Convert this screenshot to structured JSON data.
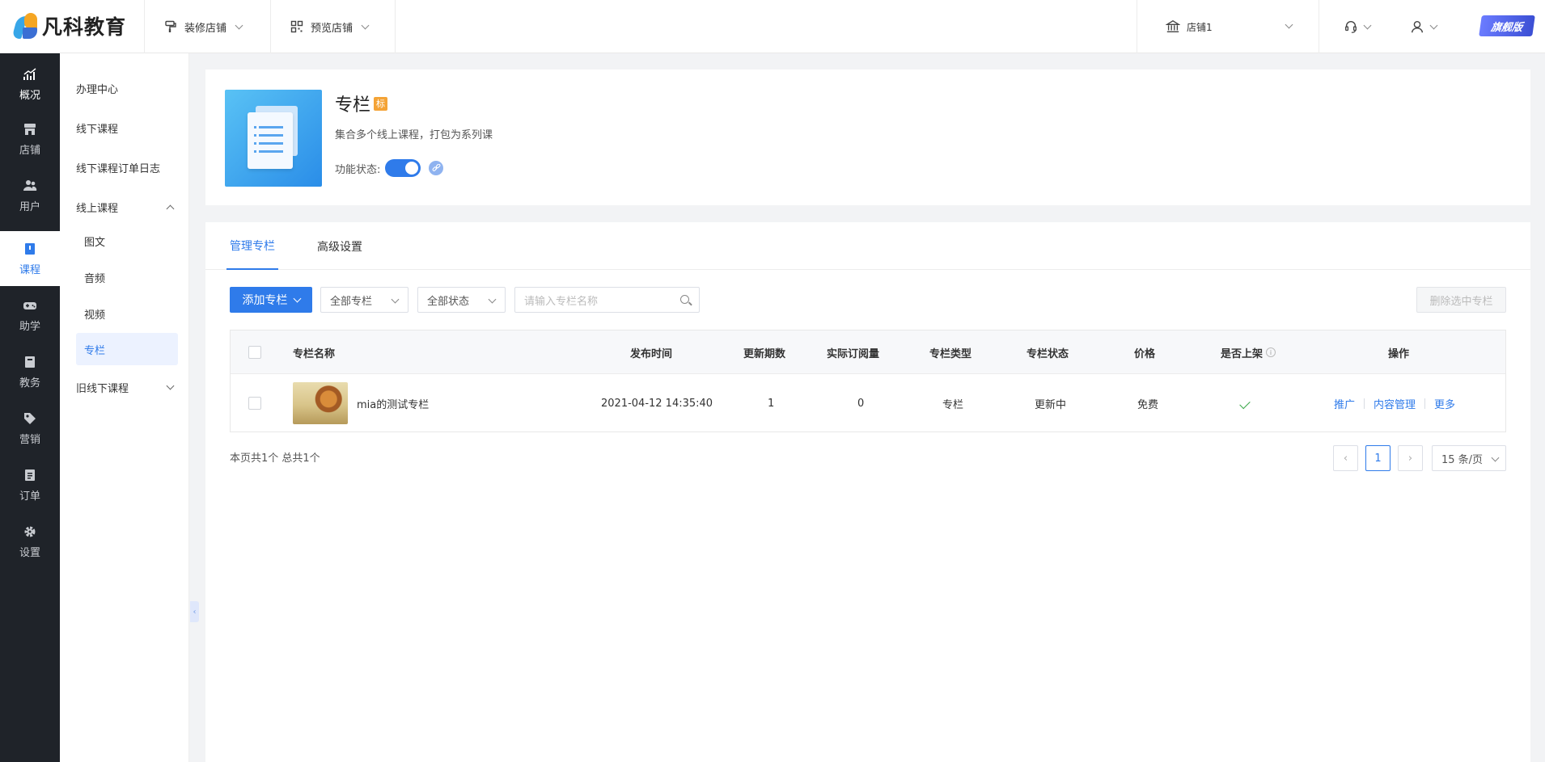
{
  "brand": {
    "name": "凡科教育"
  },
  "topbar": {
    "decorate_label": "装修店铺",
    "preview_label": "预览店铺",
    "store_label": "店铺1",
    "edition_badge": "旗舰版"
  },
  "leftnav": {
    "items": [
      {
        "label": "概况",
        "icon": "chart-icon"
      },
      {
        "label": "店铺",
        "icon": "store-icon"
      },
      {
        "label": "用户",
        "icon": "users-icon"
      },
      {
        "label": "课程",
        "icon": "course-icon"
      },
      {
        "label": "助学",
        "icon": "gamepad-icon"
      },
      {
        "label": "教务",
        "icon": "notebook-icon"
      },
      {
        "label": "营销",
        "icon": "tag-icon"
      },
      {
        "label": "订单",
        "icon": "order-icon"
      },
      {
        "label": "设置",
        "icon": "gear-icon"
      }
    ]
  },
  "subnav": {
    "items": [
      {
        "label": "办理中心"
      },
      {
        "label": "线下课程"
      },
      {
        "label": "线下课程订单日志"
      },
      {
        "label": "线上课程"
      },
      {
        "label": "图文"
      },
      {
        "label": "音频"
      },
      {
        "label": "视频"
      },
      {
        "label": "专栏"
      },
      {
        "label": "旧线下课程"
      }
    ]
  },
  "feature": {
    "title": "专栏",
    "tag": "标",
    "description": "集合多个线上课程，打包为系列课",
    "status_label": "功能状态:"
  },
  "tabs": [
    {
      "label": "管理专栏"
    },
    {
      "label": "高级设置"
    }
  ],
  "toolbar": {
    "add_label": "添加专栏",
    "filter_all_columns": "全部专栏",
    "filter_all_status": "全部状态",
    "search_placeholder": "请输入专栏名称",
    "delete_selected": "删除选中专栏"
  },
  "table": {
    "headers": {
      "name": "专栏名称",
      "publish_time": "发布时间",
      "periods": "更新期数",
      "subscriptions": "实际订阅量",
      "type": "专栏类型",
      "status": "专栏状态",
      "price": "价格",
      "listed": "是否上架",
      "actions": "操作"
    },
    "rows": [
      {
        "name": "mia的测试专栏",
        "publish_time": "2021-04-12 14:35:40",
        "periods": "1",
        "subscriptions": "0",
        "type": "专栏",
        "status": "更新中",
        "price": "免费",
        "listed": true,
        "actions": [
          "推广",
          "内容管理",
          "更多"
        ]
      }
    ]
  },
  "footer": {
    "summary": "本页共1个 总共1个",
    "current_page": "1",
    "page_size": "15 条/页"
  },
  "colors": {
    "accent": "#2f7bea",
    "nav_bg": "#1f2329"
  }
}
